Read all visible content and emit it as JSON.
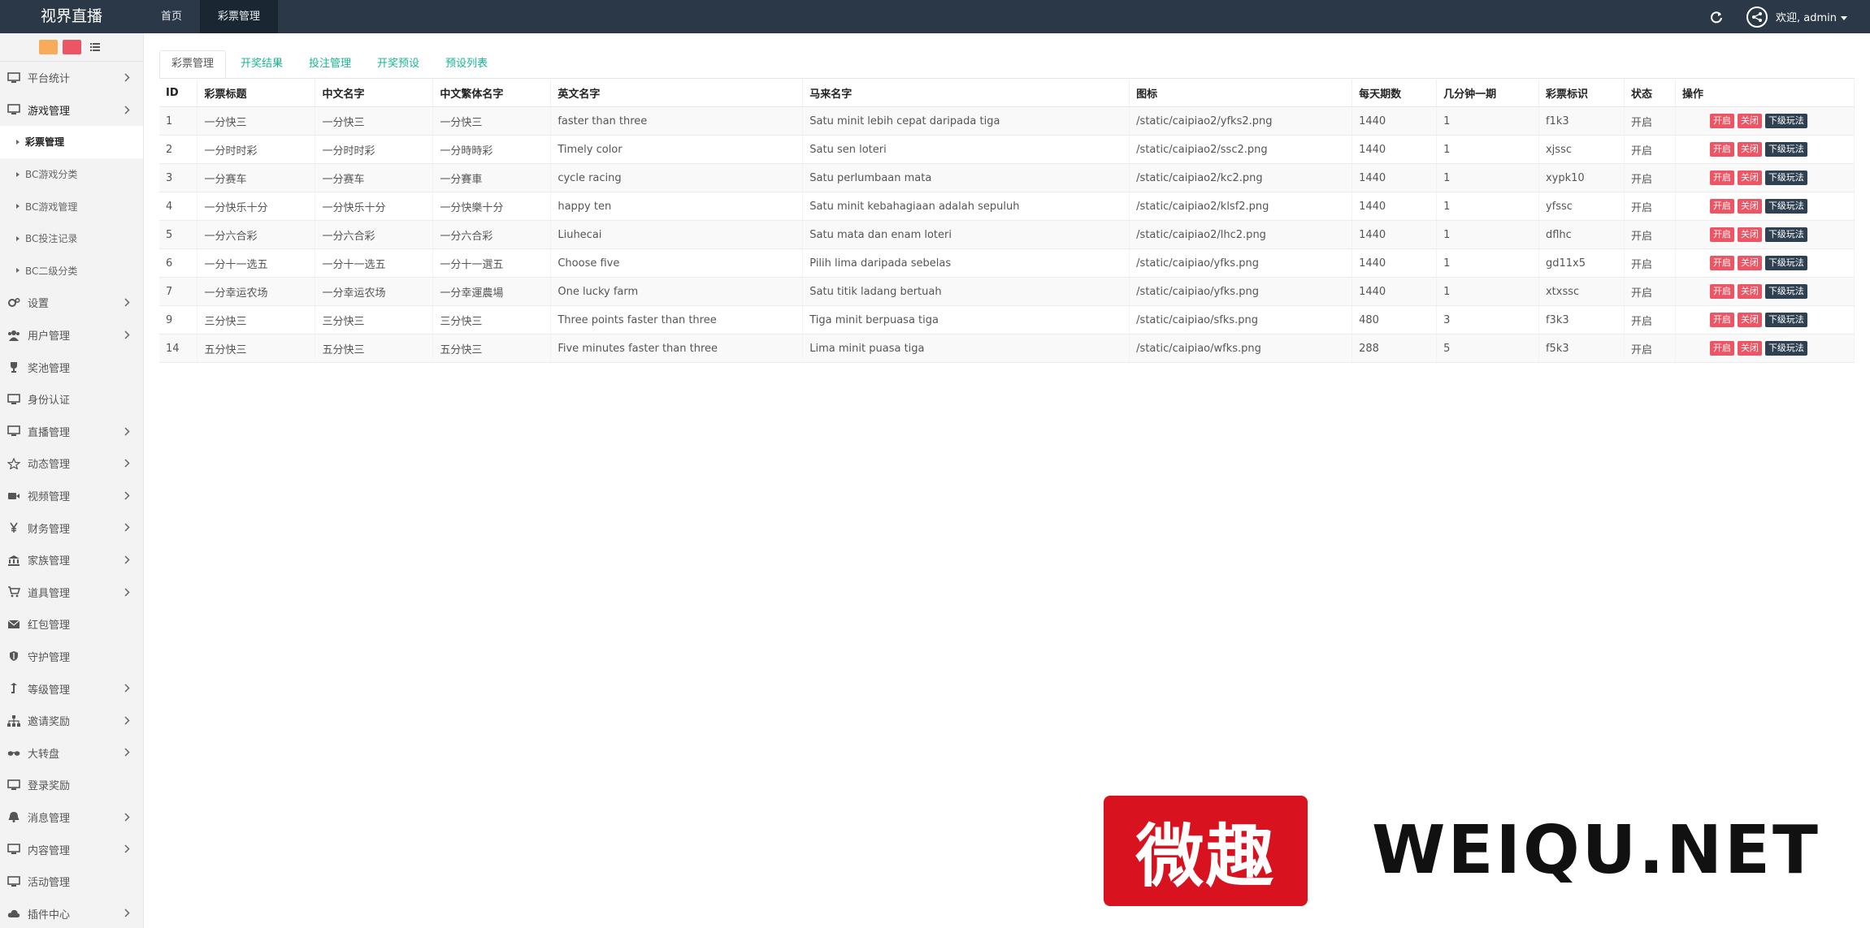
{
  "brand": "视界直播",
  "topnav": [
    {
      "label": "首页",
      "active": false
    },
    {
      "label": "彩票管理",
      "active": true
    }
  ],
  "user": {
    "welcome": "欢迎, admin"
  },
  "sidebar": {
    "tool_buttons": [
      {
        "icon": "small-orange-button",
        "glyph": "▦",
        "color": "#f8ac59"
      },
      {
        "icon": "small-red-button",
        "glyph": "▦",
        "color": "#ed5565"
      },
      {
        "icon": "list-icon"
      }
    ],
    "menu": [
      {
        "label": "平台统计",
        "icon": "monitor-icon",
        "arrow": true
      },
      {
        "label": "游戏管理",
        "icon": "monitor-icon",
        "arrow": true,
        "open": true
      },
      {
        "label": "彩票管理",
        "sub": true,
        "active": true
      },
      {
        "label": "BC游戏分类",
        "sub": true
      },
      {
        "label": "BC游戏管理",
        "sub": true
      },
      {
        "label": "BC投注记录",
        "sub": true
      },
      {
        "label": "BC二级分类",
        "sub": true
      },
      {
        "label": "设置",
        "icon": "gears-icon",
        "arrow": true
      },
      {
        "label": "用户管理",
        "icon": "users-icon",
        "arrow": true
      },
      {
        "label": "奖池管理",
        "icon": "trophy-icon",
        "arrow": false
      },
      {
        "label": "身份认证",
        "icon": "monitor-icon",
        "arrow": false
      },
      {
        "label": "直播管理",
        "icon": "monitor-icon",
        "arrow": true
      },
      {
        "label": "动态管理",
        "icon": "star-icon",
        "arrow": true
      },
      {
        "label": "视频管理",
        "icon": "video-camera-icon",
        "arrow": true
      },
      {
        "label": "财务管理",
        "icon": "yen-icon",
        "arrow": true
      },
      {
        "label": "家族管理",
        "icon": "bank-icon",
        "arrow": true
      },
      {
        "label": "道具管理",
        "icon": "cart-icon",
        "arrow": true
      },
      {
        "label": "红包管理",
        "icon": "envelope-icon",
        "arrow": false
      },
      {
        "label": "守护管理",
        "icon": "shield-icon",
        "arrow": false
      },
      {
        "label": "等级管理",
        "icon": "level-up-icon",
        "arrow": true
      },
      {
        "label": "邀请奖励",
        "icon": "sitemap-icon",
        "arrow": true
      },
      {
        "label": "大转盘",
        "icon": "glasses-icon",
        "arrow": true
      },
      {
        "label": "登录奖励",
        "icon": "monitor-icon",
        "arrow": false
      },
      {
        "label": "消息管理",
        "icon": "bell-icon",
        "arrow": true
      },
      {
        "label": "内容管理",
        "icon": "monitor-icon",
        "arrow": true
      },
      {
        "label": "活动管理",
        "icon": "monitor-icon",
        "arrow": false
      },
      {
        "label": "插件中心",
        "icon": "cloud-icon",
        "arrow": true
      }
    ]
  },
  "tabs": [
    {
      "label": "彩票管理",
      "active": true
    },
    {
      "label": "开奖结果",
      "active": false
    },
    {
      "label": "投注管理",
      "active": false
    },
    {
      "label": "开奖预设",
      "active": false
    },
    {
      "label": "预设列表",
      "active": false
    }
  ],
  "table": {
    "columns": [
      "ID",
      "彩票标题",
      "中文名字",
      "中文繁体名字",
      "英文名字",
      "马来名字",
      "图标",
      "每天期数",
      "几分钟一期",
      "彩票标识",
      "状态",
      "操作"
    ],
    "action_labels": {
      "open": "开启",
      "close": "关闭",
      "sub": "下级玩法"
    },
    "rows": [
      [
        "1",
        "一分快三",
        "一分快三",
        "一分快三",
        "faster than three",
        "Satu minit lebih cepat daripada tiga",
        "/static/caipiao2/yfks2.png",
        "1440",
        "1",
        "f1k3",
        "开启"
      ],
      [
        "2",
        "一分时时彩",
        "一分时时彩",
        "一分時時彩",
        "Timely color",
        "Satu sen loteri",
        "/static/caipiao2/ssc2.png",
        "1440",
        "1",
        "xjssc",
        "开启"
      ],
      [
        "3",
        "一分赛车",
        "一分赛车",
        "一分賽車",
        "cycle racing",
        "Satu perlumbaan mata",
        "/static/caipiao2/kc2.png",
        "1440",
        "1",
        "xypk10",
        "开启"
      ],
      [
        "4",
        "一分快乐十分",
        "一分快乐十分",
        "一分快樂十分",
        "happy ten",
        "Satu minit kebahagiaan adalah sepuluh",
        "/static/caipiao2/klsf2.png",
        "1440",
        "1",
        "yfssc",
        "开启"
      ],
      [
        "5",
        "一分六合彩",
        "一分六合彩",
        "一分六合彩",
        "Liuhecai",
        "Satu mata dan enam loteri",
        "/static/caipiao2/lhc2.png",
        "1440",
        "1",
        "dflhc",
        "开启"
      ],
      [
        "6",
        "一分十一选五",
        "一分十一选五",
        "一分十一選五",
        "Choose five",
        "Pilih lima daripada sebelas",
        "/static/caipiao/yfks.png",
        "1440",
        "1",
        "gd11x5",
        "开启"
      ],
      [
        "7",
        "一分幸运农场",
        "一分幸运农场",
        "一分幸運農場",
        "One lucky farm",
        "Satu titik ladang bertuah",
        "/static/caipiao/yfks.png",
        "1440",
        "1",
        "xtxssc",
        "开启"
      ],
      [
        "9",
        "三分快三",
        "三分快三",
        "三分快三",
        "Three points faster than three",
        "Tiga minit berpuasa tiga",
        "/static/caipiao/sfks.png",
        "480",
        "3",
        "f3k3",
        "开启"
      ],
      [
        "14",
        "五分快三",
        "五分快三",
        "五分快三",
        "Five minutes faster than three",
        "Lima minit puasa tiga",
        "/static/caipiao/wfks.png",
        "288",
        "5",
        "f5k3",
        "开启"
      ]
    ]
  },
  "watermark": {
    "logo_text": "微趣",
    "site_text": "WEIQU.NET",
    "logo_color": "#d8121f"
  },
  "colors": {
    "navbar": "#2b3847",
    "accent": "#1ab394",
    "danger": "#ed5565",
    "dark_button": "#2f4050"
  }
}
